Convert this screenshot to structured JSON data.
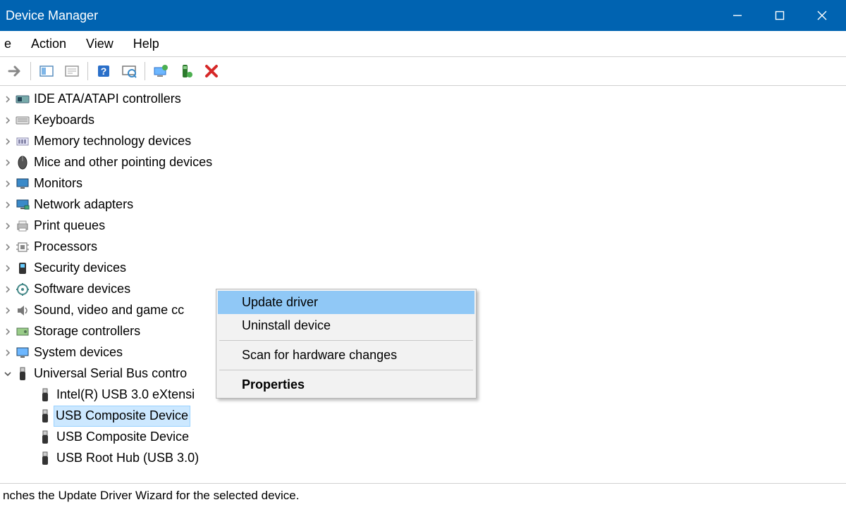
{
  "window": {
    "title": "Device Manager"
  },
  "menu": {
    "file": "e",
    "action": "Action",
    "view": "View",
    "help": "Help"
  },
  "tree": {
    "items": [
      {
        "label": "IDE ATA/ATAPI controllers",
        "expanded": false,
        "icon": "ide"
      },
      {
        "label": "Keyboards",
        "expanded": false,
        "icon": "keyboard"
      },
      {
        "label": "Memory technology devices",
        "expanded": false,
        "icon": "memory"
      },
      {
        "label": "Mice and other pointing devices",
        "expanded": false,
        "icon": "mouse"
      },
      {
        "label": "Monitors",
        "expanded": false,
        "icon": "monitor"
      },
      {
        "label": "Network adapters",
        "expanded": false,
        "icon": "network"
      },
      {
        "label": "Print queues",
        "expanded": false,
        "icon": "printer"
      },
      {
        "label": "Processors",
        "expanded": false,
        "icon": "processor"
      },
      {
        "label": "Security devices",
        "expanded": false,
        "icon": "security"
      },
      {
        "label": "Software devices",
        "expanded": false,
        "icon": "software"
      },
      {
        "label": "Sound, video and game cc",
        "expanded": false,
        "icon": "sound"
      },
      {
        "label": "Storage controllers",
        "expanded": false,
        "icon": "storage"
      },
      {
        "label": "System devices",
        "expanded": false,
        "icon": "system"
      },
      {
        "label": "Universal Serial Bus contro",
        "expanded": true,
        "icon": "usb",
        "children": [
          {
            "label": "Intel(R) USB 3.0 eXtensi",
            "icon": "usb"
          },
          {
            "label": "USB Composite Device",
            "icon": "usb",
            "selected": true
          },
          {
            "label": "USB Composite Device",
            "icon": "usb"
          },
          {
            "label": "USB Root Hub (USB 3.0)",
            "icon": "usb"
          }
        ]
      }
    ]
  },
  "context_menu": {
    "update": "Update driver",
    "uninstall": "Uninstall device",
    "scan": "Scan for hardware changes",
    "properties": "Properties"
  },
  "statusbar": {
    "text": "nches the Update Driver Wizard for the selected device."
  }
}
